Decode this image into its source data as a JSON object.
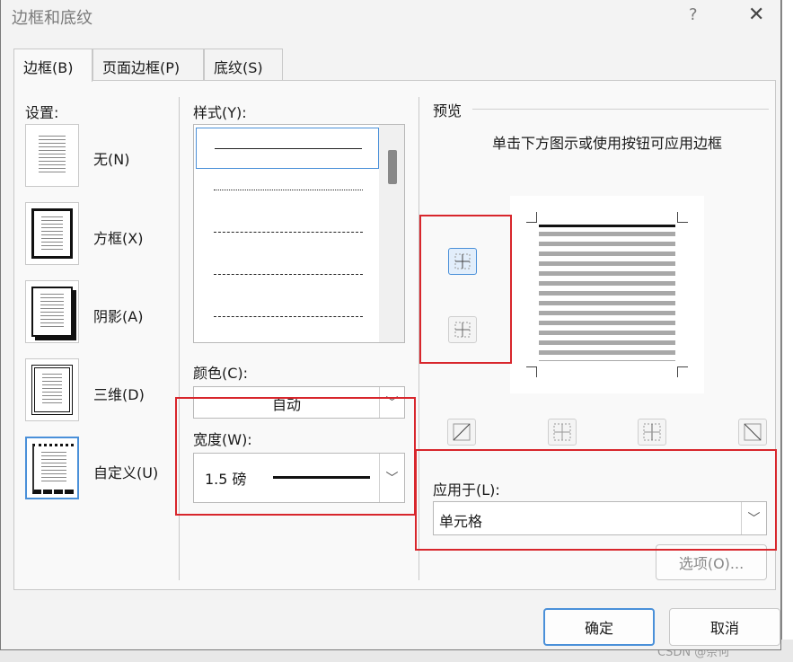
{
  "window": {
    "title": "边框和底纹",
    "help": "?",
    "close": "✕"
  },
  "tabs": [
    {
      "label": "边框(B)"
    },
    {
      "label": "页面边框(P)"
    },
    {
      "label": "底纹(S)"
    }
  ],
  "settings": {
    "heading": "设置:",
    "items": [
      {
        "label": "无(N)"
      },
      {
        "label": "方框(X)"
      },
      {
        "label": "阴影(A)"
      },
      {
        "label": "三维(D)"
      },
      {
        "label": "自定义(U)"
      }
    ],
    "selected": "自定义(U)"
  },
  "style": {
    "heading": "样式(Y):",
    "selected_index": 0
  },
  "color": {
    "heading": "颜色(C):",
    "value": "自动"
  },
  "width": {
    "heading": "宽度(W):",
    "value": "1.5 磅"
  },
  "preview": {
    "heading": "预览",
    "instruction": "单击下方图示或使用按钮可应用边框"
  },
  "apply_to": {
    "heading": "应用于(L):",
    "value": "单元格"
  },
  "buttons": {
    "options": "选项(O)...",
    "ok": "确定",
    "cancel": "取消"
  },
  "background": {
    "watermark": "CSDN @奈何"
  },
  "colors": {
    "accent": "#4a90d9",
    "highlight": "#d8262c"
  }
}
